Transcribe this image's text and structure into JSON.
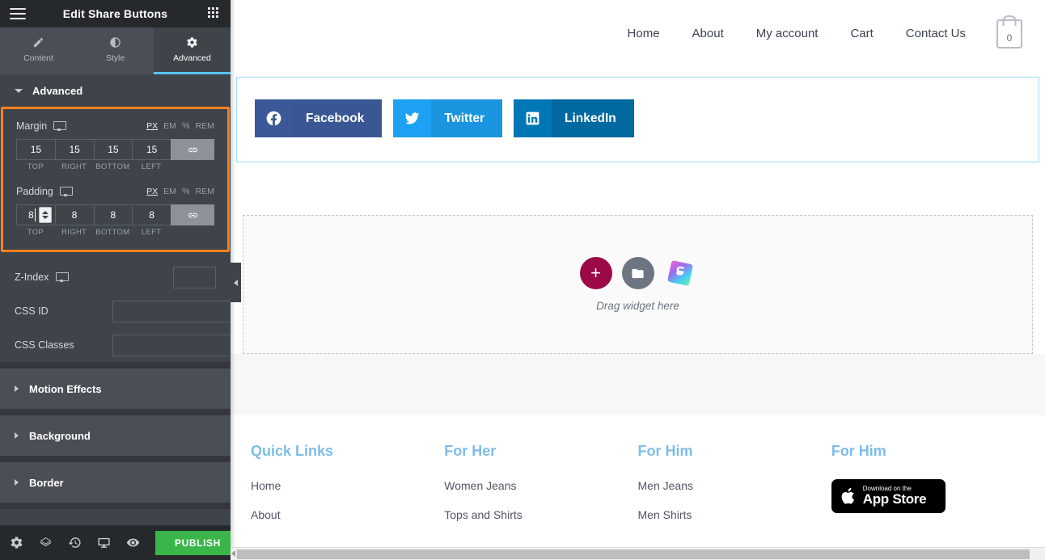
{
  "panel": {
    "title": "Edit Share Buttons",
    "menu_icon": "hamburger-icon",
    "apps_icon": "grid-icon",
    "tabs": [
      {
        "label": "Content",
        "icon": "pencil-icon",
        "active": false
      },
      {
        "label": "Style",
        "icon": "contrast-icon",
        "active": false
      },
      {
        "label": "Advanced",
        "icon": "gear-icon",
        "active": true
      }
    ],
    "advanced_section": {
      "title": "Advanced",
      "expanded": true
    },
    "margin": {
      "label": "Margin",
      "device_icon": "desktop-icon",
      "units": [
        "PX",
        "EM",
        "%",
        "REM"
      ],
      "active_unit": "PX",
      "values": {
        "top": "15",
        "right": "15",
        "bottom": "15",
        "left": "15"
      },
      "sides": [
        "TOP",
        "RIGHT",
        "BOTTOM",
        "LEFT"
      ],
      "link_icon": "link-icon",
      "linked": true
    },
    "padding": {
      "label": "Padding",
      "device_icon": "desktop-icon",
      "units": [
        "PX",
        "EM",
        "%",
        "REM"
      ],
      "active_unit": "PX",
      "values": {
        "top": "8",
        "right": "8",
        "bottom": "8",
        "left": "8"
      },
      "sides": [
        "TOP",
        "RIGHT",
        "BOTTOM",
        "LEFT"
      ],
      "link_icon": "link-icon",
      "linked": true,
      "focused_field": "top"
    },
    "z_index": {
      "label": "Z-Index",
      "device_icon": "desktop-icon",
      "value": "",
      "placeholder": ""
    },
    "css_id": {
      "label": "CSS ID",
      "value": "",
      "placeholder": "",
      "dynamic_icon": "database-icon"
    },
    "css_classes": {
      "label": "CSS Classes",
      "value": "",
      "placeholder": "",
      "dynamic_icon": "database-icon"
    },
    "accordions": [
      {
        "label": "Motion Effects",
        "expanded": false
      },
      {
        "label": "Background",
        "expanded": false
      },
      {
        "label": "Border",
        "expanded": false
      }
    ],
    "footer": {
      "icons": [
        "gear-icon",
        "layers-icon",
        "history-icon",
        "responsive-icon",
        "preview-icon"
      ],
      "publish_label": "PUBLISH",
      "publish_arrow_icon": "caret-up-icon"
    },
    "highlight_color": "#f5811f",
    "accent_color": "#59c2f5"
  },
  "preview": {
    "nav": {
      "links": [
        "Home",
        "About",
        "My account",
        "Cart",
        "Contact Us"
      ],
      "cart_icon": "shopping-bag-icon",
      "cart_count": "0"
    },
    "share_widget": {
      "selected": true,
      "selection_color": "#9fdcf2",
      "buttons": [
        {
          "label": "Facebook",
          "icon": "facebook-icon",
          "icon_bg": "#3b5998",
          "label_bg": "#3a5795"
        },
        {
          "label": "Twitter",
          "icon": "twitter-icon",
          "icon_bg": "#1da1f2",
          "label_bg": "#1b95e0"
        },
        {
          "label": "LinkedIn",
          "icon": "linkedin-icon",
          "icon_bg": "#0077b5",
          "label_bg": "#0069a0"
        }
      ]
    },
    "drop_zone": {
      "text": "Drag widget here",
      "add_icon": "plus-icon",
      "template_icon": "folder-icon",
      "addon_icon": "s-logo-icon"
    },
    "footer_columns": [
      {
        "title": "Quick Links",
        "links": [
          "Home",
          "About"
        ]
      },
      {
        "title": "For Her",
        "links": [
          "Women Jeans",
          "Tops and Shirts"
        ]
      },
      {
        "title": "For Him",
        "links": [
          "Men Jeans",
          "Men Shirts"
        ]
      },
      {
        "title": "For Him",
        "links": []
      }
    ],
    "app_store": {
      "small_text": "Download on the",
      "big_text": "App Store",
      "icon": "apple-icon"
    },
    "collapse_handle_icon": "chevron-left-icon"
  }
}
